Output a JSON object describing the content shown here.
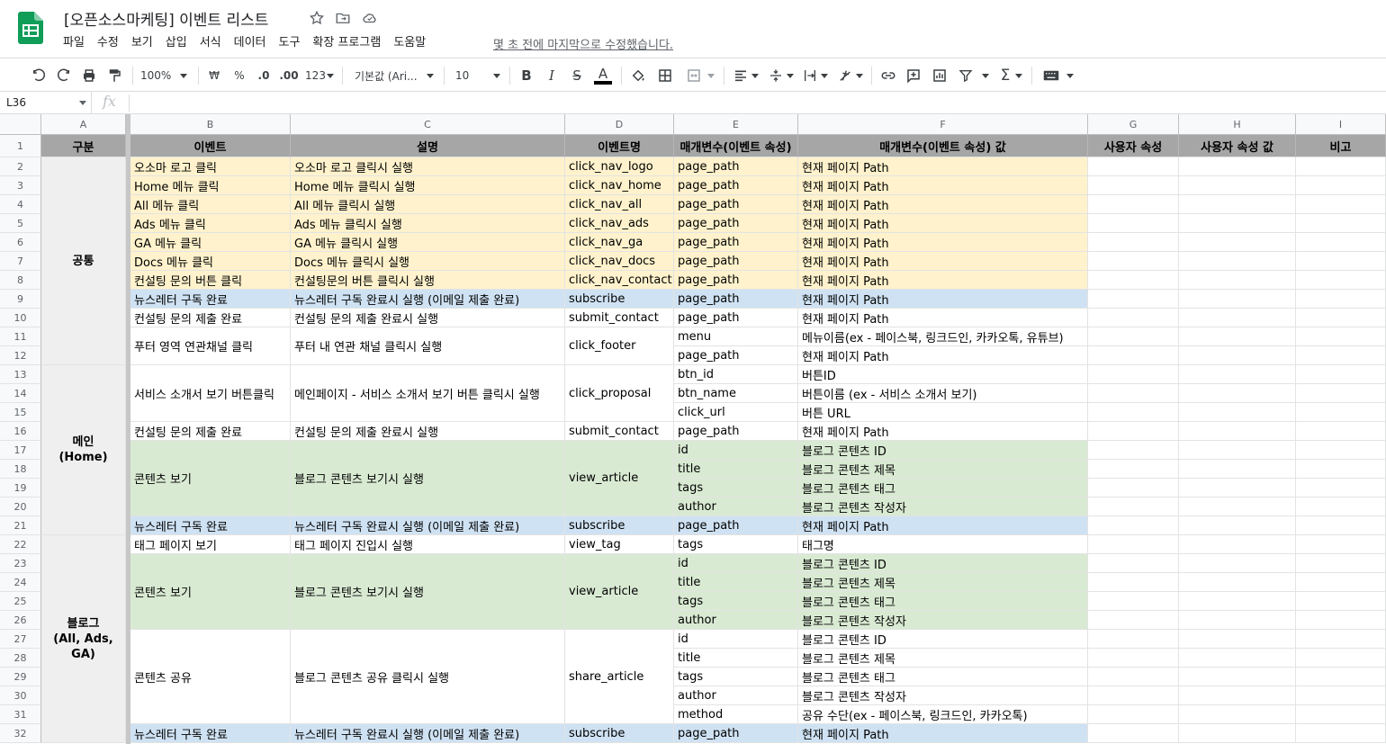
{
  "app": {
    "title": "[오픈소스마케팅] 이벤트 리스트",
    "last_edit": "몇 초 전에 마지막으로 수정했습니다."
  },
  "menus": [
    "파일",
    "수정",
    "보기",
    "삽입",
    "서식",
    "데이터",
    "도구",
    "확장 프로그램",
    "도움말"
  ],
  "toolbar": {
    "zoom": "100%",
    "currency": "₩",
    "percent": "%",
    "dec_less": ".0",
    "dec_more": ".00",
    "format_more": "123",
    "font": "기본값 (Ari...",
    "font_size": "10"
  },
  "formula": {
    "cell_ref": "L36",
    "fx": "fx",
    "value": ""
  },
  "columns": [
    "A",
    "B",
    "C",
    "D",
    "E",
    "F",
    "G",
    "H",
    "I"
  ],
  "rows": [
    "1",
    "2",
    "3",
    "4",
    "5",
    "6",
    "7",
    "8",
    "9",
    "10",
    "11",
    "12",
    "13",
    "14",
    "15",
    "16",
    "17",
    "18",
    "19",
    "20",
    "21",
    "22",
    "23",
    "24",
    "25",
    "26",
    "27",
    "28",
    "29",
    "30",
    "31",
    "32"
  ],
  "header": [
    "구분",
    "이벤트",
    "설명",
    "이벤트명",
    "매개변수(이벤트 속성)",
    "매개변수(이벤트 속성) 값",
    "사용자 속성",
    "사용자 속성 값",
    "비고"
  ],
  "categories": [
    "공통",
    "메인\n(Home)",
    "블로그\n(All, Ads, GA)"
  ],
  "events": [
    {
      "b": "오소마 로고 클릭",
      "c": "오소마 로고 클릭시 실행",
      "d": "click_nav_logo"
    },
    {
      "b": "Home 메뉴 클릭",
      "c": "Home 메뉴 클릭시 실행",
      "d": "click_nav_home"
    },
    {
      "b": "All 메뉴 클릭",
      "c": "All 메뉴 클릭시 실행",
      "d": "click_nav_all"
    },
    {
      "b": "Ads 메뉴 클릭",
      "c": "Ads 메뉴 클릭시 실행",
      "d": "click_nav_ads"
    },
    {
      "b": "GA 메뉴 클릭",
      "c": "GA 메뉴 클릭시 실행",
      "d": "click_nav_ga"
    },
    {
      "b": "Docs 메뉴 클릭",
      "c": "Docs 메뉴 클릭시 실행",
      "d": "click_nav_docs"
    },
    {
      "b": "컨설팅 문의 버튼 클릭",
      "c": "컨설팅문의 버튼 클릭시 실행",
      "d": "click_nav_contact"
    },
    {
      "b": "뉴스레터 구독 완료",
      "c": "뉴스레터 구독 완료시 실행 (이메일 제출 완료)",
      "d": "subscribe"
    },
    {
      "b": "컨설팅 문의 제출 완료",
      "c": "컨설팅 문의 제출 완료시 실행",
      "d": "submit_contact"
    },
    {
      "b": "푸터 영역 연관채널 클릭",
      "c": "푸터 내 연관 채널 클릭시 실행",
      "d": "click_footer"
    },
    {
      "b": "서비스 소개서 보기 버튼클릭",
      "c": "메인페이지 - 서비스 소개서 보기 버튼 클릭시 실행",
      "d": "click_proposal"
    },
    {
      "b": "컨설팅 문의 제출 완료",
      "c": "컨설팅 문의 제출 완료시 실행",
      "d": "submit_contact"
    },
    {
      "b": "콘텐츠 보기",
      "c": "블로그 콘텐츠 보기시 실행",
      "d": "view_article"
    },
    {
      "b": "뉴스레터 구독 완료",
      "c": "뉴스레터 구독 완료시 실행 (이메일 제출 완료)",
      "d": "subscribe"
    },
    {
      "b": "태그 페이지 보기",
      "c": "태그 페이지 진입시 실행",
      "d": "view_tag"
    },
    {
      "b": "콘텐츠 보기",
      "c": "블로그 콘텐츠 보기시 실행",
      "d": "view_article"
    },
    {
      "b": "콘텐츠 공유",
      "c": "블로그 콘텐츠 공유 클릭시 실행",
      "d": "share_article"
    },
    {
      "b": "뉴스레터 구독 완료",
      "c": "뉴스레터 구독 완료시 실행 (이메일 제출 완료)",
      "d": "subscribe"
    }
  ],
  "params": [
    {
      "e": "page_path",
      "f": "현재 페이지 Path"
    },
    {
      "e": "page_path",
      "f": "현재 페이지 Path"
    },
    {
      "e": "page_path",
      "f": "현재 페이지 Path"
    },
    {
      "e": "page_path",
      "f": "현재 페이지 Path"
    },
    {
      "e": "page_path",
      "f": "현재 페이지 Path"
    },
    {
      "e": "page_path",
      "f": "현재 페이지 Path"
    },
    {
      "e": "page_path",
      "f": "현재 페이지 Path"
    },
    {
      "e": "page_path",
      "f": "현재 페이지 Path"
    },
    {
      "e": "page_path",
      "f": "현재 페이지 Path"
    },
    {
      "e": "menu",
      "f": "메뉴이름(ex - 페이스북, 링크드인, 카카오톡, 유튜브)"
    },
    {
      "e": "page_path",
      "f": "현재 페이지 Path"
    },
    {
      "e": "btn_id",
      "f": "버튼ID"
    },
    {
      "e": "btn_name",
      "f": "버튼이름 (ex - 서비스 소개서 보기)"
    },
    {
      "e": "click_url",
      "f": "버튼 URL"
    },
    {
      "e": "page_path",
      "f": "현재 페이지 Path"
    },
    {
      "e": "id",
      "f": "블로그 콘텐츠 ID"
    },
    {
      "e": "title",
      "f": "블로그 콘텐츠 제목"
    },
    {
      "e": "tags",
      "f": "블로그 콘텐츠 태그"
    },
    {
      "e": "author",
      "f": "블로그 콘텐츠 작성자"
    },
    {
      "e": "page_path",
      "f": "현재 페이지 Path"
    },
    {
      "e": "tags",
      "f": "태그명"
    },
    {
      "e": "id",
      "f": "블로그 콘텐츠 ID"
    },
    {
      "e": "title",
      "f": "블로그 콘텐츠 제목"
    },
    {
      "e": "tags",
      "f": "블로그 콘텐츠 태그"
    },
    {
      "e": "author",
      "f": "블로그 콘텐츠 작성자"
    },
    {
      "e": "id",
      "f": "블로그 콘텐츠 ID"
    },
    {
      "e": "title",
      "f": "블로그 콘텐츠 제목"
    },
    {
      "e": "tags",
      "f": "블로그 콘텐츠 태그"
    },
    {
      "e": "author",
      "f": "블로그 콘텐츠 작성자"
    },
    {
      "e": "method",
      "f": "공유 수단(ex - 페이스북, 링크드인, 카카오톡)"
    },
    {
      "e": "page_path",
      "f": "현재 페이지 Path"
    }
  ],
  "colors": {
    "yellow": "#fff2cc",
    "blue": "#cfe2f3",
    "green": "#d9ead3",
    "header": "#a6a6a6",
    "category": "#efefef",
    "logo": "#0f9d58"
  }
}
